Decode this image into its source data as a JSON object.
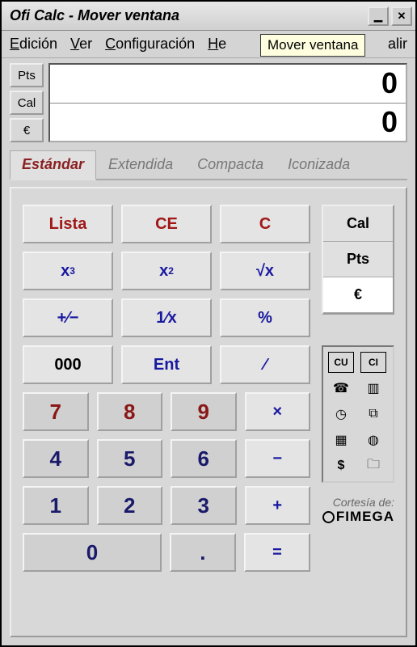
{
  "title": "Ofi Calc - Mover ventana",
  "tooltip": "Mover ventana",
  "menu": {
    "edicion": "Edición",
    "ver": "Ver",
    "config": "Configuración",
    "help": "He",
    "salir": "alir"
  },
  "disp": {
    "pts": "Pts",
    "cal": "Cal",
    "eur": "€",
    "val1": "0",
    "val2": "0"
  },
  "tabs": {
    "estandar": "Estándar",
    "extendida": "Extendida",
    "compacta": "Compacta",
    "iconizada": "Iconizada"
  },
  "keys": {
    "lista": "Lista",
    "ce": "CE",
    "c": "C",
    "x3": "x",
    "x3sup": "3",
    "x2": "x",
    "x2sup": "2",
    "sqrt": "√x",
    "pm": "+⁄−",
    "inv": "1⁄x",
    "pct": "%",
    "tzero": "000",
    "ent": "Ent",
    "slash": "⁄",
    "n7": "7",
    "n8": "8",
    "n9": "9",
    "mul": "×",
    "n4": "4",
    "n5": "5",
    "n6": "6",
    "sub": "−",
    "n1": "1",
    "n2": "2",
    "n3": "3",
    "add": "+",
    "n0": "0",
    "dot": ".",
    "eq": "="
  },
  "units": {
    "cal": "Cal",
    "pts": "Pts",
    "eur": "€"
  },
  "iconlabels": {
    "cu": "CU",
    "ci": "CI"
  },
  "credits": {
    "cortesia": "Cortesía de:",
    "brand": "FIMEGA"
  }
}
